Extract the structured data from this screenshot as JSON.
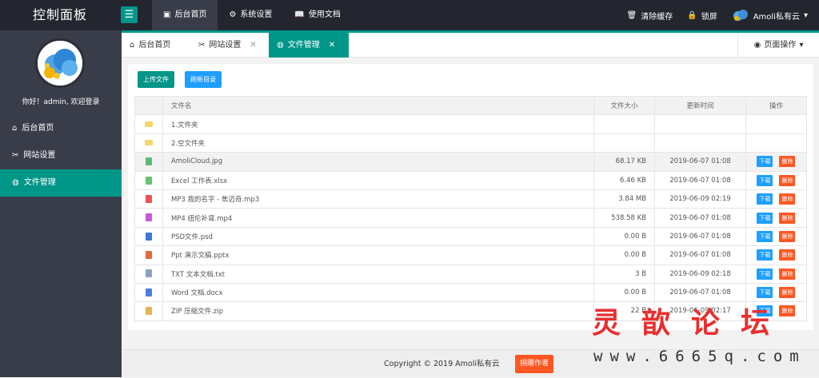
{
  "topbar": {
    "brand": "控制面板",
    "nav": [
      {
        "label": "后台首页",
        "icon": "home-icon"
      },
      {
        "label": "系统设置",
        "icon": "gear-icon"
      },
      {
        "label": "使用文档",
        "icon": "book-icon"
      }
    ],
    "clear_cache": "清除缓存",
    "lock": "锁屏",
    "user": "Amoli私有云"
  },
  "sidebar": {
    "welcome": "你好！admin, 欢迎登录",
    "items": [
      {
        "label": "后台首页",
        "icon": "home-icon"
      },
      {
        "label": "网站设置",
        "icon": "tools-icon"
      },
      {
        "label": "文件管理",
        "icon": "globe-icon"
      }
    ]
  },
  "tabs": [
    {
      "label": "后台首页"
    },
    {
      "label": "网站设置",
      "close": "✕"
    },
    {
      "label": "文件管理",
      "close": "✕"
    }
  ],
  "page_ops": "页面操作",
  "toolbar": {
    "upload": "上传文件",
    "refresh": "刷新目录"
  },
  "table": {
    "headers": {
      "name": "文件名",
      "size": "文件大小",
      "time": "更新时间",
      "ops": "操作"
    },
    "download_label": "下载",
    "delete_label": "删除",
    "rows": [
      {
        "name": "1.文件夹",
        "size": "",
        "time": "",
        "type": "folder"
      },
      {
        "name": "2.空文件夹",
        "size": "",
        "time": "",
        "type": "folder"
      },
      {
        "name": "AmoliCloud.jpg",
        "size": "68.17 KB",
        "time": "2019-06-07 01:08",
        "type": "image"
      },
      {
        "name": "Excel 工作表.xlsx",
        "size": "6.46 KB",
        "time": "2019-06-07 01:08",
        "type": "excel"
      },
      {
        "name": "MP3 我的名字 - 焦迈奇.mp3",
        "size": "3.84 MB",
        "time": "2019-06-09 02:19",
        "type": "audio"
      },
      {
        "name": "MP4 纽伦补肾.mp4",
        "size": "538.58 KB",
        "time": "2019-06-07 01:08",
        "type": "video"
      },
      {
        "name": "PSD文件.psd",
        "size": "0.00 B",
        "time": "2019-06-07 01:08",
        "type": "psd"
      },
      {
        "name": "Ppt 演示文稿.pptx",
        "size": "0.00 B",
        "time": "2019-06-07 01:08",
        "type": "ppt"
      },
      {
        "name": "TXT 文本文档.txt",
        "size": "3 B",
        "time": "2019-06-09 02:18",
        "type": "txt"
      },
      {
        "name": "Word 文档.docx",
        "size": "0.00 B",
        "time": "2019-06-07 01:08",
        "type": "word"
      },
      {
        "name": "ZIP 压缩文件.zip",
        "size": "22 B",
        "time": "2019-06-09 02:17",
        "type": "zip"
      }
    ]
  },
  "footer": {
    "copyright": "Copyright © 2019 Amoli私有云",
    "donate": "捐赠作者"
  },
  "watermark": {
    "cn": "灵歆论坛",
    "url": "www.6665q.com"
  },
  "colors": {
    "accent": "#009688",
    "blue": "#1e9fff",
    "red": "#ff5722",
    "image": "#5fb878",
    "excel": "#67c46f",
    "audio": "#e85454",
    "video": "#c85ad6",
    "psd": "#3a7bd5",
    "ppt": "#e8663c",
    "txt": "#8ea1c2",
    "word": "#4a7fd8",
    "zip": "#e3b54e"
  }
}
